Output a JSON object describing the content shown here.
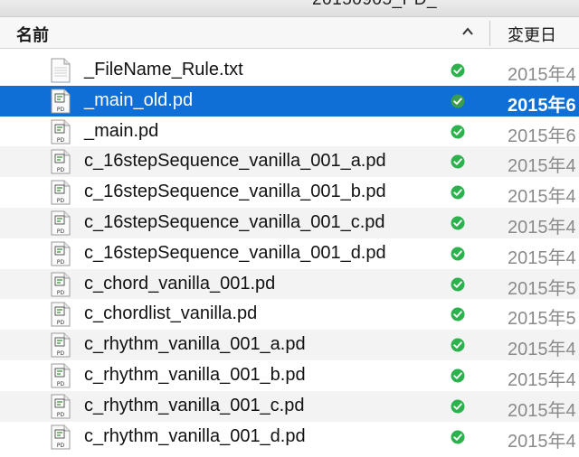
{
  "window": {
    "title": "20150905_PD_"
  },
  "header": {
    "name_label": "名前",
    "sort_icon": "chevron-up-icon",
    "date_label": "変更日"
  },
  "colors": {
    "selection": "#0f6fd7",
    "status_green": "#2bb24c",
    "date_text": "#8a8a8a"
  },
  "files": [
    {
      "name": "_FileName_Rule.txt",
      "date": "2015年4",
      "icon": "text-file-icon",
      "status": "synced-check-icon",
      "selected": false
    },
    {
      "name": "_main_old.pd",
      "date": "2015年6",
      "icon": "pd-file-icon",
      "status": "synced-check-icon",
      "selected": true
    },
    {
      "name": "_main.pd",
      "date": "2015年6",
      "icon": "pd-file-icon",
      "status": "synced-check-icon",
      "selected": false
    },
    {
      "name": "c_16stepSequence_vanilla_001_a.pd",
      "date": "2015年4",
      "icon": "pd-file-icon",
      "status": "synced-check-icon",
      "selected": false
    },
    {
      "name": "c_16stepSequence_vanilla_001_b.pd",
      "date": "2015年4",
      "icon": "pd-file-icon",
      "status": "synced-check-icon",
      "selected": false
    },
    {
      "name": "c_16stepSequence_vanilla_001_c.pd",
      "date": "2015年4",
      "icon": "pd-file-icon",
      "status": "synced-check-icon",
      "selected": false
    },
    {
      "name": "c_16stepSequence_vanilla_001_d.pd",
      "date": "2015年4",
      "icon": "pd-file-icon",
      "status": "synced-check-icon",
      "selected": false
    },
    {
      "name": "c_chord_vanilla_001.pd",
      "date": "2015年5",
      "icon": "pd-file-icon",
      "status": "synced-check-icon",
      "selected": false
    },
    {
      "name": "c_chordlist_vanilla.pd",
      "date": "2015年5",
      "icon": "pd-file-icon",
      "status": "synced-check-icon",
      "selected": false
    },
    {
      "name": "c_rhythm_vanilla_001_a.pd",
      "date": "2015年4",
      "icon": "pd-file-icon",
      "status": "synced-check-icon",
      "selected": false
    },
    {
      "name": "c_rhythm_vanilla_001_b.pd",
      "date": "2015年4",
      "icon": "pd-file-icon",
      "status": "synced-check-icon",
      "selected": false
    },
    {
      "name": "c_rhythm_vanilla_001_c.pd",
      "date": "2015年4",
      "icon": "pd-file-icon",
      "status": "synced-check-icon",
      "selected": false
    },
    {
      "name": "c_rhythm_vanilla_001_d.pd",
      "date": "2015年4",
      "icon": "pd-file-icon",
      "status": "synced-check-icon",
      "selected": false
    }
  ]
}
